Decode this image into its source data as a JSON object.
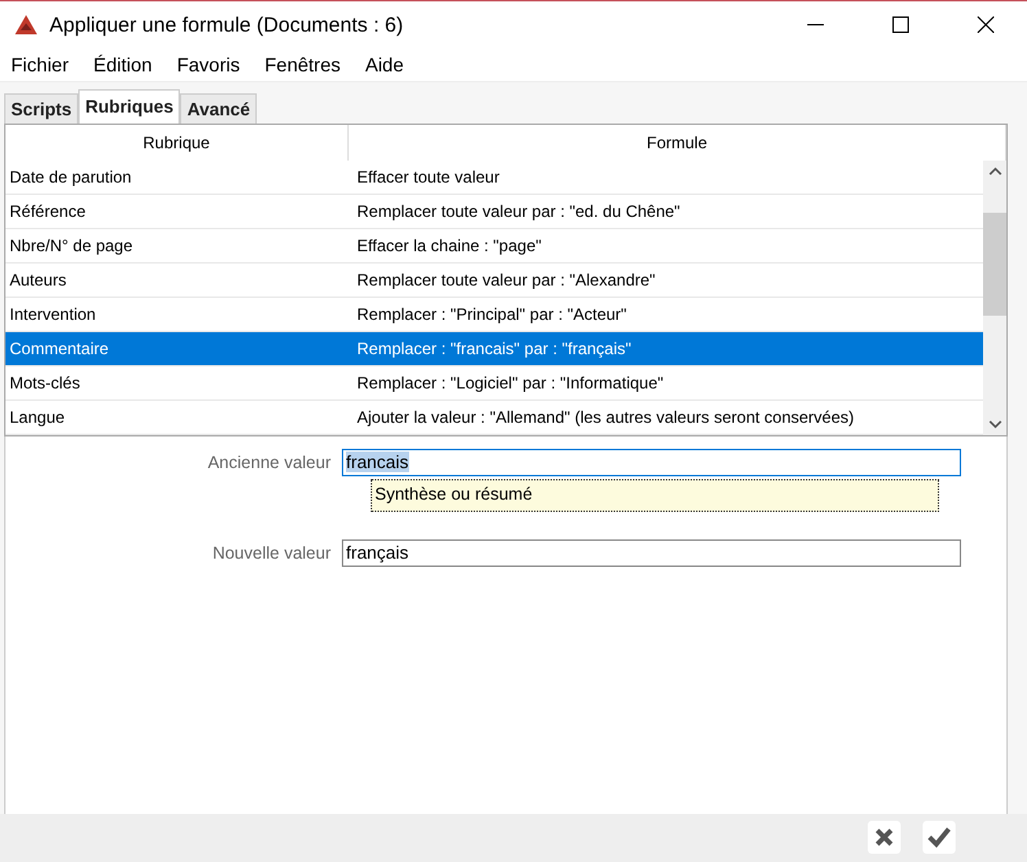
{
  "window": {
    "title": "Appliquer une formule (Documents : 6)"
  },
  "menu": [
    "Fichier",
    "Édition",
    "Favoris",
    "Fenêtres",
    "Aide"
  ],
  "tabs": [
    {
      "label": "Scripts",
      "selected": false
    },
    {
      "label": "Rubriques",
      "selected": true
    },
    {
      "label": "Avancé",
      "selected": false
    }
  ],
  "table": {
    "columns": [
      "Rubrique",
      "Formule"
    ],
    "rows": [
      {
        "rubrique": "Date de parution",
        "formule": "Effacer toute valeur",
        "selected": false
      },
      {
        "rubrique": "Référence",
        "formule": "Remplacer toute valeur par : \"ed. du Chêne\"",
        "selected": false
      },
      {
        "rubrique": "Nbre/N° de page",
        "formule": "Effacer la chaine : \"page\"",
        "selected": false
      },
      {
        "rubrique": "Auteurs",
        "formule": "Remplacer toute valeur par : \"Alexandre\"",
        "selected": false
      },
      {
        "rubrique": "Intervention",
        "formule": "Remplacer : \"Principal\" par : \"Acteur\"",
        "selected": false
      },
      {
        "rubrique": "Commentaire",
        "formule": "Remplacer : \"francais\" par : \"français\"",
        "selected": true
      },
      {
        "rubrique": "Mots-clés",
        "formule": "Remplacer : \"Logiciel\" par : \"Informatique\"",
        "selected": false
      },
      {
        "rubrique": "Langue",
        "formule": "Ajouter la valeur : \"Allemand\" (les autres valeurs seront conservées)",
        "selected": false
      }
    ]
  },
  "form": {
    "old_value": {
      "label": "Ancienne valeur",
      "value": "francais",
      "focused": true,
      "text_selected": true
    },
    "suggestion": "Synthèse ou résumé",
    "new_value": {
      "label": "Nouvelle valeur",
      "value": "français",
      "focused": false,
      "text_selected": false
    }
  }
}
